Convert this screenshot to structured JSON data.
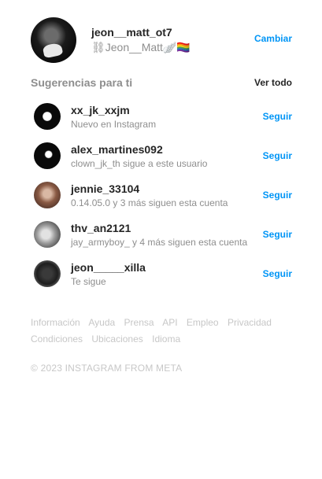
{
  "profile": {
    "username": "jeon__matt_ot7",
    "full_name": "⛓Jeon__Matt🪽🏳️‍🌈",
    "switch_label": "Cambiar"
  },
  "suggestions": {
    "title": "Sugerencias para ti",
    "see_all": "Ver todo",
    "items": [
      {
        "username": "xx_jk_xxjm",
        "subtitle": "Nuevo en Instagram",
        "action": "Seguir"
      },
      {
        "username": "alex_martines092",
        "subtitle": "clown_jk_th sigue a este usuario",
        "action": "Seguir"
      },
      {
        "username": "jennie_33104",
        "subtitle": "0.14.05.0 y 3 más siguen esta cuenta",
        "action": "Seguir"
      },
      {
        "username": "thv_an2121",
        "subtitle": "jay_armyboy_ y 4 más siguen esta cuenta",
        "action": "Seguir"
      },
      {
        "username": "jeon_____xilla",
        "subtitle": "Te sigue",
        "action": "Seguir"
      }
    ]
  },
  "footer": {
    "links": [
      "Información",
      "Ayuda",
      "Prensa",
      "API",
      "Empleo",
      "Privacidad",
      "Condiciones",
      "Ubicaciones",
      "Idioma"
    ],
    "copyright": "© 2023 INSTAGRAM FROM META"
  },
  "colors": {
    "accent": "#0095f6",
    "text_primary": "#262626",
    "text_secondary": "#8e8e8e",
    "footer_text": "#c7c7c7"
  }
}
